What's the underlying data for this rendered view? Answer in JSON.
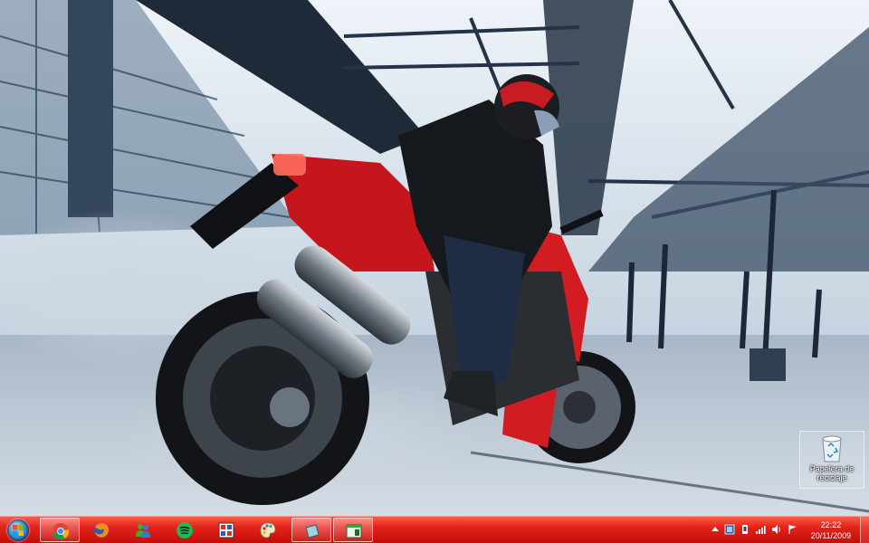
{
  "desktop": {
    "wallpaper": "ducati-streetfighter-burnout",
    "icons": [
      {
        "name": "recycle-bin-icon",
        "label": "Papelera de reciclaje"
      }
    ]
  },
  "taskbar": {
    "color": "#e2231a",
    "start": {
      "icon": "windows-start-orb"
    },
    "pinned": [
      {
        "name": "chrome-icon",
        "active": true
      },
      {
        "name": "firefox-icon",
        "active": false
      },
      {
        "name": "messenger-icon",
        "active": false
      },
      {
        "name": "spotify-icon",
        "active": false
      },
      {
        "name": "media-app-icon",
        "active": false
      },
      {
        "name": "paint-icon",
        "active": false
      },
      {
        "name": "window-app-1-icon",
        "active": true
      },
      {
        "name": "window-app-2-icon",
        "active": true
      }
    ],
    "tray": {
      "icons": [
        "show-hidden-icons",
        "network-app-icon",
        "device-icon",
        "signal-icon",
        "volume-icon",
        "action-center-flag-icon"
      ],
      "time": "22:22",
      "date": "20/11/2009"
    }
  }
}
